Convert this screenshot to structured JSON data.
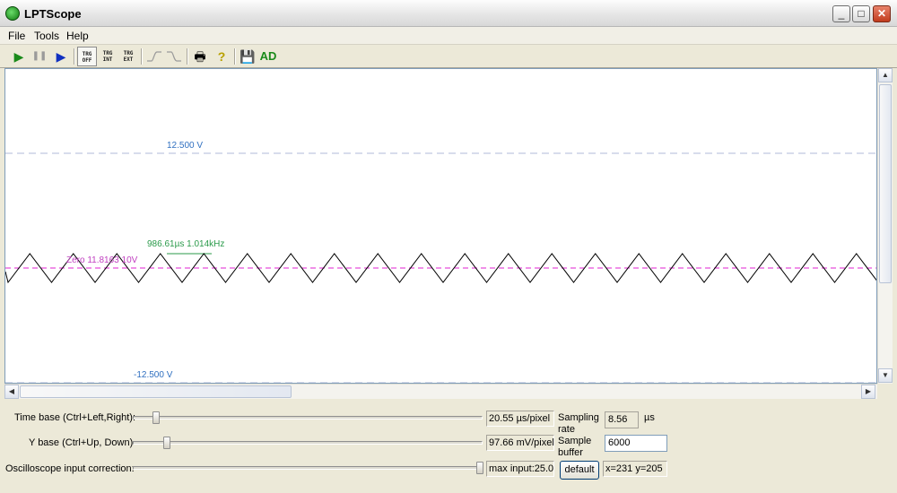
{
  "window": {
    "title": "LPTScope",
    "minimize_glyph": "_",
    "maximize_glyph": "□",
    "close_glyph": "✕"
  },
  "menu": {
    "file": "File",
    "tools": "Tools",
    "help": "Help"
  },
  "toolbar": {
    "play_glyph": "▶",
    "pause_glyph": "❚❚",
    "step_glyph": "▶",
    "trg_off_top": "TRG",
    "trg_off_bottom": "OFF",
    "trg_int_top": "TRG",
    "trg_int_bottom": "INT",
    "trg_ext_top": "TRG",
    "trg_ext_bottom": "EXT",
    "print_glyph": "🖶",
    "help_glyph": "?",
    "save_glyph": "💾",
    "ad_label": "AD",
    "colors": {
      "play": "#1a8a1a",
      "step": "#1030c0",
      "ad": "#1a8a1a",
      "help": "#b8a000"
    }
  },
  "scope": {
    "upper_limit_label": "12.500 V",
    "lower_limit_label": "-12.500 V",
    "zero_label": "Zero  11.8163 10V",
    "measure_label": "986.61µs  1.014kHz",
    "colors": {
      "limit_line": "#b0b8d8",
      "limit_text": "#3070c0",
      "zero_line": "#e020d0",
      "zero_text": "#c040c0",
      "measure": "#2a9a4a",
      "trace": "#000000"
    }
  },
  "controls": {
    "time_base_label": "Time base (Ctrl+Left,Right):",
    "time_base_value": "20.55 µs/pixel",
    "y_base_label": "Y base (Ctrl+Up, Down)",
    "y_base_value": "97.66 mV/pixel",
    "correction_label": "Oscilloscope input correction:",
    "correction_value": "max input:25.0",
    "sampling_rate_label_1": "Sampling",
    "sampling_rate_label_2": "rate",
    "sampling_rate_value": "8.56",
    "sampling_rate_unit": "µs",
    "sample_buffer_label_1": "Sample",
    "sample_buffer_label_2": "buffer",
    "sample_buffer_value": "6000",
    "default_button": "default",
    "cursor_readout": "x=231  y=205"
  }
}
